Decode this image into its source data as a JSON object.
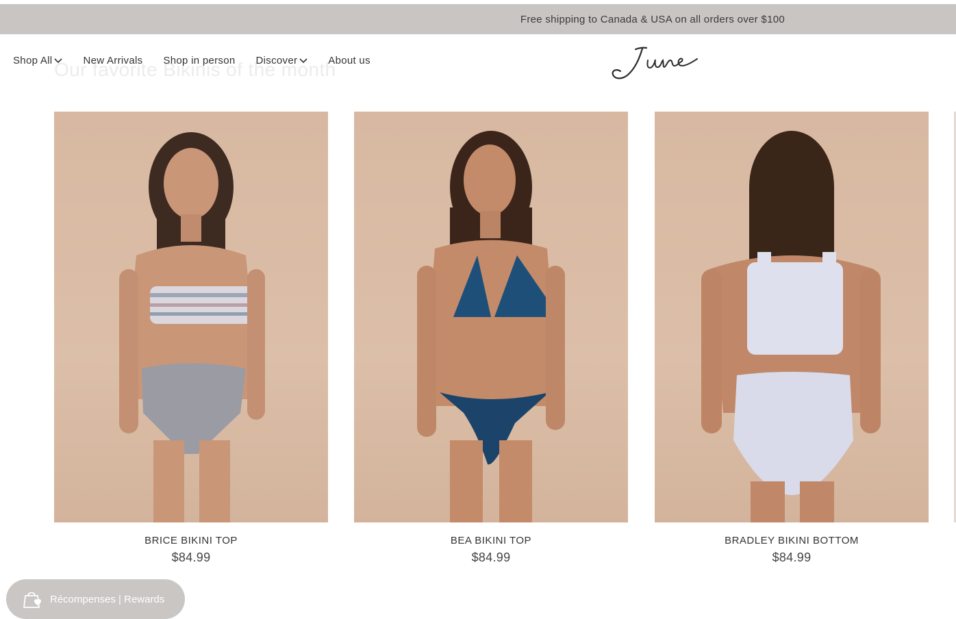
{
  "announcement": "Free shipping to Canada & USA on all orders over $100",
  "nav": {
    "items": [
      {
        "label": "Shop All",
        "has_dropdown": true
      },
      {
        "label": "New Arrivals",
        "has_dropdown": false
      },
      {
        "label": "Shop in person",
        "has_dropdown": false
      },
      {
        "label": "Discover",
        "has_dropdown": true
      },
      {
        "label": "About us",
        "has_dropdown": false
      }
    ]
  },
  "logo_text": "June",
  "section_title": "Our favorite Bikinis of the month",
  "products": [
    {
      "name": "BRICE BIKINI TOP",
      "price": "$84.99"
    },
    {
      "name": "BEA BIKINI TOP",
      "price": "$84.99"
    },
    {
      "name": "BRADLEY BIKINI BOTTOM",
      "price": "$84.99"
    }
  ],
  "rewards_label": "Récompenses | Rewards",
  "colors": {
    "announcement_bg": "#c8c5c3",
    "photo_bg": "#d8b8a1",
    "rewards_bg": "#c9c6c4"
  }
}
